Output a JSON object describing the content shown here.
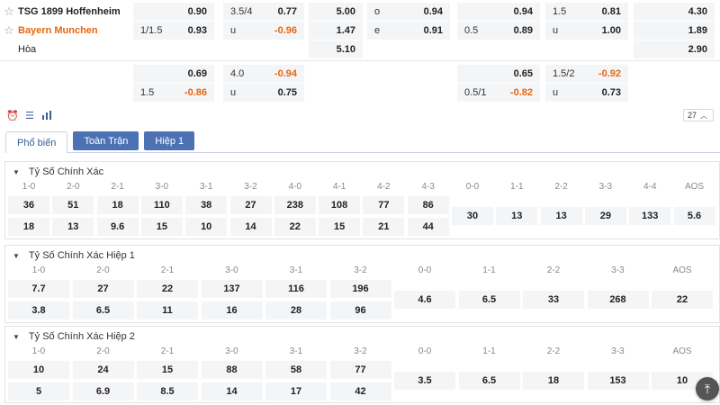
{
  "teams": {
    "home": "TSG 1899 Hoffenheim",
    "away": "Bayern Munchen",
    "draw": "Hòa"
  },
  "odds_main": {
    "row1": [
      {
        "k": "",
        "v": "0.90"
      },
      {
        "k": "3.5/4",
        "v": "0.77"
      },
      {
        "k": "",
        "v": "5.00"
      },
      {
        "k": "o",
        "v": "0.94"
      },
      {
        "k": "",
        "v": "0.94"
      },
      {
        "k": "1.5",
        "v": "0.81"
      },
      {
        "k": "",
        "v": "4.30"
      }
    ],
    "row2": [
      {
        "k": "1/1.5",
        "v": "0.93"
      },
      {
        "k": "u",
        "v": "-0.96"
      },
      {
        "k": "",
        "v": "1.47"
      },
      {
        "k": "e",
        "v": "0.91"
      },
      {
        "k": "0.5",
        "v": "0.89"
      },
      {
        "k": "u",
        "v": "1.00"
      },
      {
        "k": "",
        "v": "1.89"
      }
    ],
    "row3": [
      {
        "k": "",
        "v": "5.10"
      },
      {
        "k": "",
        "v": "2.90"
      }
    ]
  },
  "odds_alt": {
    "row1": [
      {
        "k": "",
        "v": "0.69"
      },
      {
        "k": "4.0",
        "v": "-0.94"
      },
      {
        "k": "",
        "v": "0.65"
      },
      {
        "k": "1.5/2",
        "v": "-0.92"
      }
    ],
    "row2": [
      {
        "k": "1.5",
        "v": "-0.86"
      },
      {
        "k": "u",
        "v": "0.75"
      },
      {
        "k": "0.5/1",
        "v": "-0.82"
      },
      {
        "k": "u",
        "v": "0.73"
      }
    ]
  },
  "toolbar": {
    "icons": [
      "alarm-clock-icon",
      "list-icon",
      "bar-chart-icon"
    ],
    "page_size": "27"
  },
  "tabs": [
    "Phổ biến",
    "Toàn Trận",
    "Hiệp 1"
  ],
  "sections": [
    {
      "title": "Tỷ Số Chính Xác",
      "labels": [
        "1-0",
        "2-0",
        "2-1",
        "3-0",
        "3-1",
        "3-2",
        "4-0",
        "4-1",
        "4-2",
        "4-3",
        "0-0",
        "1-1",
        "2-2",
        "3-3",
        "4-4",
        "AOS"
      ],
      "home": [
        "36",
        "51",
        "18",
        "110",
        "38",
        "27",
        "238",
        "108",
        "77",
        "86"
      ],
      "away": [
        "18",
        "13",
        "9.6",
        "15",
        "10",
        "14",
        "22",
        "15",
        "21",
        "44"
      ],
      "draw": [
        "30",
        "13",
        "13",
        "29",
        "133",
        "5.6"
      ]
    },
    {
      "title": "Tỷ Số Chính Xác Hiệp 1",
      "labels": [
        "1-0",
        "2-0",
        "2-1",
        "3-0",
        "3-1",
        "3-2",
        "0-0",
        "1-1",
        "2-2",
        "3-3",
        "AOS"
      ],
      "home": [
        "7.7",
        "27",
        "22",
        "137",
        "116",
        "196"
      ],
      "away": [
        "3.8",
        "6.5",
        "11",
        "16",
        "28",
        "96"
      ],
      "draw": [
        "4.6",
        "6.5",
        "33",
        "268",
        "22"
      ]
    },
    {
      "title": "Tỷ Số Chính Xác Hiệp 2",
      "labels": [
        "1-0",
        "2-0",
        "2-1",
        "3-0",
        "3-1",
        "3-2",
        "0-0",
        "1-1",
        "2-2",
        "3-3",
        "AOS"
      ],
      "home": [
        "10",
        "24",
        "15",
        "88",
        "58",
        "77"
      ],
      "away": [
        "5",
        "6.9",
        "8.5",
        "14",
        "17",
        "42"
      ],
      "draw": [
        "3.5",
        "6.5",
        "18",
        "153",
        "10"
      ]
    }
  ]
}
